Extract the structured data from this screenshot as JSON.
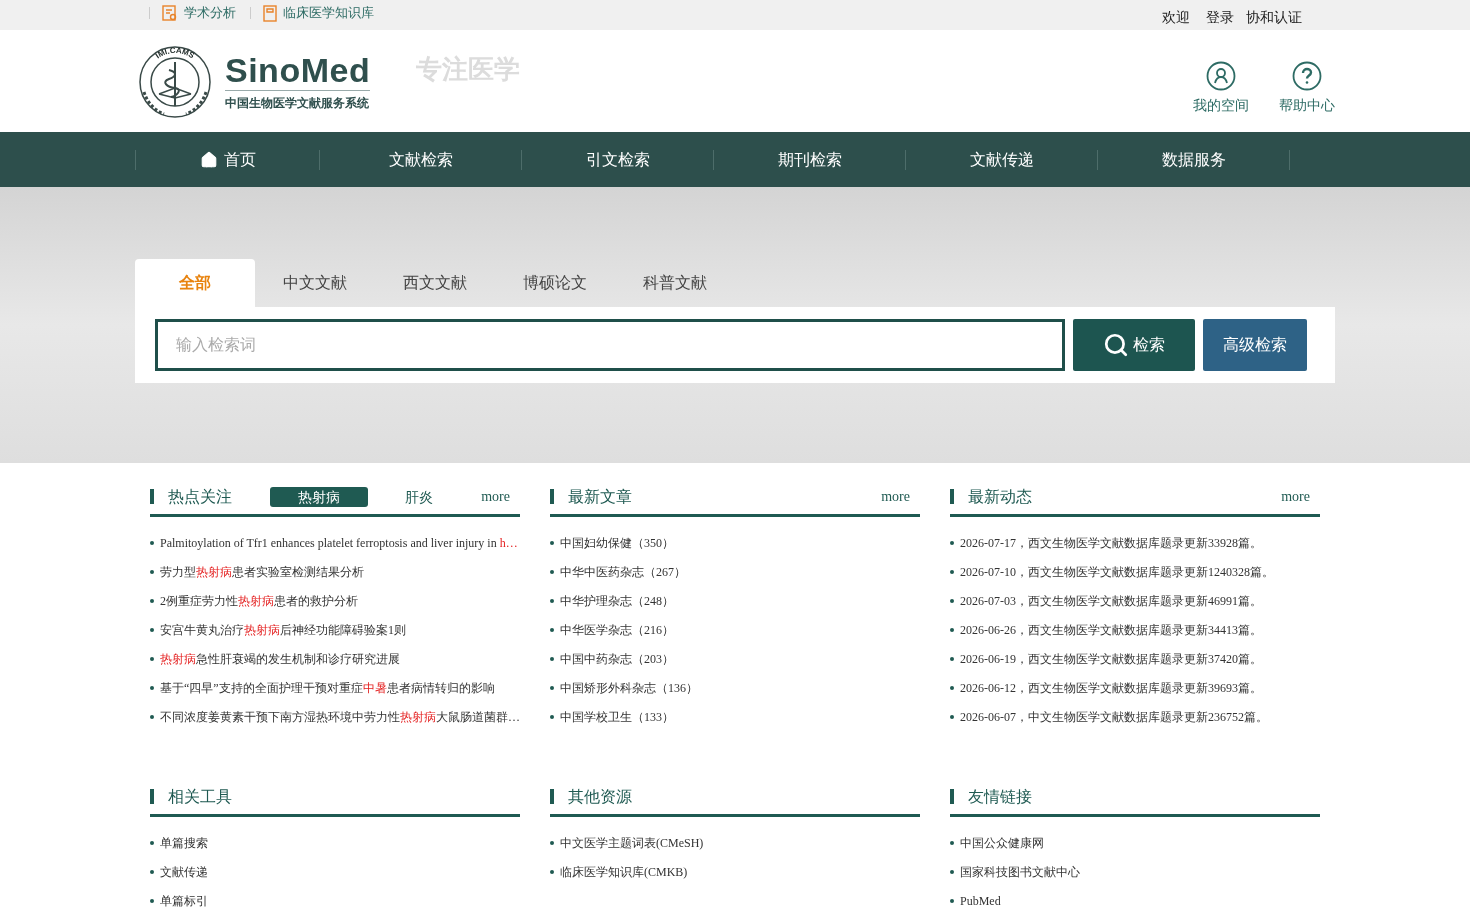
{
  "top_bar": {
    "links": [
      {
        "label": "学术分析"
      },
      {
        "label": "临床医学知识库"
      }
    ],
    "user_links": [
      "欢迎",
      "登录",
      "协和认证"
    ]
  },
  "header": {
    "logo": {
      "emblem_text": "IMI.CAMS",
      "name": "SinoMed",
      "subtitle": "中国生物医学文献服务系统"
    },
    "slogan": "专注医学",
    "actions": [
      {
        "label": "我的空间"
      },
      {
        "label": "帮助中心"
      }
    ]
  },
  "nav": [
    {
      "label": "首页"
    },
    {
      "label": "文献检索"
    },
    {
      "label": "引文检索"
    },
    {
      "label": "期刊检索"
    },
    {
      "label": "文献传递"
    },
    {
      "label": "数据服务"
    }
  ],
  "search": {
    "tabs": [
      {
        "label": "全部",
        "selected": true
      },
      {
        "label": "中文文献",
        "selected": false
      },
      {
        "label": "西文文献",
        "selected": false
      },
      {
        "label": "博硕论文",
        "selected": false
      },
      {
        "label": "科普文献",
        "selected": false
      }
    ],
    "placeholder": "输入检索词",
    "search_button": "检索",
    "advanced_button": "高级检索"
  },
  "sections": [
    {
      "title": "热点关注",
      "tabs": [
        {
          "label": "热射病",
          "selected": true
        },
        {
          "label": "肝炎",
          "selected": false
        }
      ],
      "more": "more",
      "items": [
        [
          {
            "text": "Palmitoylation of Tfr1 enhances platelet ferroptosis and liver injury in "
          },
          {
            "text": "h…",
            "highlight": true
          }
        ],
        [
          {
            "text": "劳力型"
          },
          {
            "text": "热射病",
            "highlight": true
          },
          {
            "text": "患者实验室检测结果分析"
          }
        ],
        [
          {
            "text": "2例重症劳力性"
          },
          {
            "text": "热射病",
            "highlight": true
          },
          {
            "text": "患者的救护分析"
          }
        ],
        [
          {
            "text": "安宫牛黄丸治疗"
          },
          {
            "text": "热射病",
            "highlight": true
          },
          {
            "text": "后神经功能障碍验案1则"
          }
        ],
        [
          {
            "text": "热射病",
            "highlight": true
          },
          {
            "text": "急性肝衰竭的发生机制和诊疗研究进展"
          }
        ],
        [
          {
            "text": "基于“四早”支持的全面护理干预对重症"
          },
          {
            "text": "中暑",
            "highlight": true
          },
          {
            "text": "患者病情转归的影响"
          }
        ],
        [
          {
            "text": "不同浓度姜黄素干预下南方湿热环境中劳力性"
          },
          {
            "text": "热射病",
            "highlight": true
          },
          {
            "text": "大鼠肠道菌群…"
          }
        ]
      ]
    },
    {
      "title": "最新文章",
      "more": "more",
      "items": [
        [
          {
            "text": "中国妇幼保健（350）"
          }
        ],
        [
          {
            "text": "中华中医药杂志（267）"
          }
        ],
        [
          {
            "text": "中华护理杂志（248）"
          }
        ],
        [
          {
            "text": "中华医学杂志（216）"
          }
        ],
        [
          {
            "text": "中国中药杂志（203）"
          }
        ],
        [
          {
            "text": "中国矫形外科杂志（136）"
          }
        ],
        [
          {
            "text": "中国学校卫生（133）"
          }
        ]
      ]
    },
    {
      "title": "最新动态",
      "more": "more",
      "items": [
        [
          {
            "text": "2026-07-17，西文生物医学文献数据库题录更新33928篇。"
          }
        ],
        [
          {
            "text": "2026-07-10，西文生物医学文献数据库题录更新1240328篇。"
          }
        ],
        [
          {
            "text": "2026-07-03，西文生物医学文献数据库题录更新46991篇。"
          }
        ],
        [
          {
            "text": "2026-06-26，西文生物医学文献数据库题录更新34413篇。"
          }
        ],
        [
          {
            "text": "2026-06-19，西文生物医学文献数据库题录更新37420篇。"
          }
        ],
        [
          {
            "text": "2026-06-12，西文生物医学文献数据库题录更新39693篇。"
          }
        ],
        [
          {
            "text": "2026-06-07，中文生物医学文献数据库题录更新236752篇。"
          }
        ]
      ]
    },
    {
      "title": "相关工具",
      "items": [
        [
          {
            "text": "单篇搜索"
          }
        ],
        [
          {
            "text": "文献传递"
          }
        ],
        [
          {
            "text": "单篇标引"
          }
        ]
      ]
    },
    {
      "title": "其他资源",
      "items": [
        [
          {
            "text": "中文医学主题词表(CMeSH)"
          }
        ],
        [
          {
            "text": "临床医学知识库(CMKB)"
          }
        ]
      ]
    },
    {
      "title": "友情链接",
      "items": [
        [
          {
            "text": "中国公众健康网"
          }
        ],
        [
          {
            "text": "国家科技图书文献中心"
          }
        ],
        [
          {
            "text": "PubMed"
          }
        ]
      ]
    }
  ]
}
